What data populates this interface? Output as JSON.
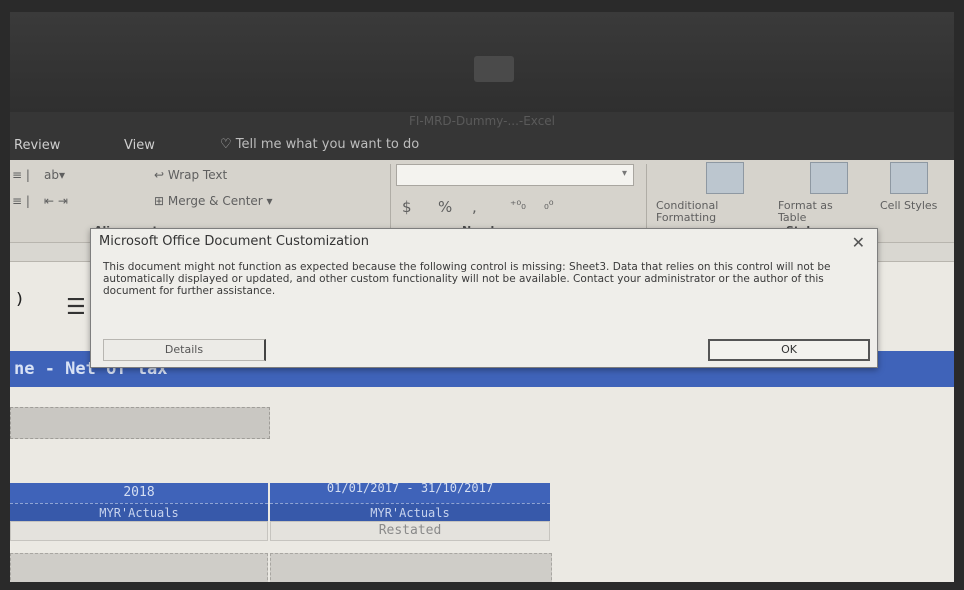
{
  "window": {
    "title": "FI-MRD-Dummy-...-Excel"
  },
  "menu": {
    "tabs": [
      "Review",
      "View"
    ],
    "tell_me": "Tell me what you want to do"
  },
  "ribbon": {
    "alignment": {
      "wrap_text": "Wrap Text",
      "merge_center": "Merge & Center",
      "group_label": "Alignment"
    },
    "number": {
      "currency": "$",
      "percent": "%",
      "comma": ",",
      "group_label": "Number"
    },
    "styles": {
      "conditional": "Conditional Formatting",
      "format_table": "Format as Table",
      "cell_styles": "Cell Styles",
      "group_label": "Styles"
    }
  },
  "dialog": {
    "title": "Microsoft Office Document Customization",
    "close": "✕",
    "message": "This document might not function as expected because the following control is missing: Sheet3. Data that relies on this control will not be automatically displayed or updated, and other custom functionality will not be available. Contact your administrator or the author of this document for further assistance.",
    "details_label": "Details",
    "ok_label": "OK"
  },
  "sheet": {
    "banner_text": "ne - Net of tax",
    "columns": [
      {
        "header": "2018",
        "sub": "MYR'Actuals",
        "note": ""
      },
      {
        "header": "01/01/2017 - 31/10/2017",
        "sub": "MYR'Actuals",
        "note": "Restated"
      }
    ]
  },
  "colors": {
    "banner": "#3f63b9",
    "dialog_bg": "#efeeea",
    "titlebar": "#2f2f2f"
  }
}
